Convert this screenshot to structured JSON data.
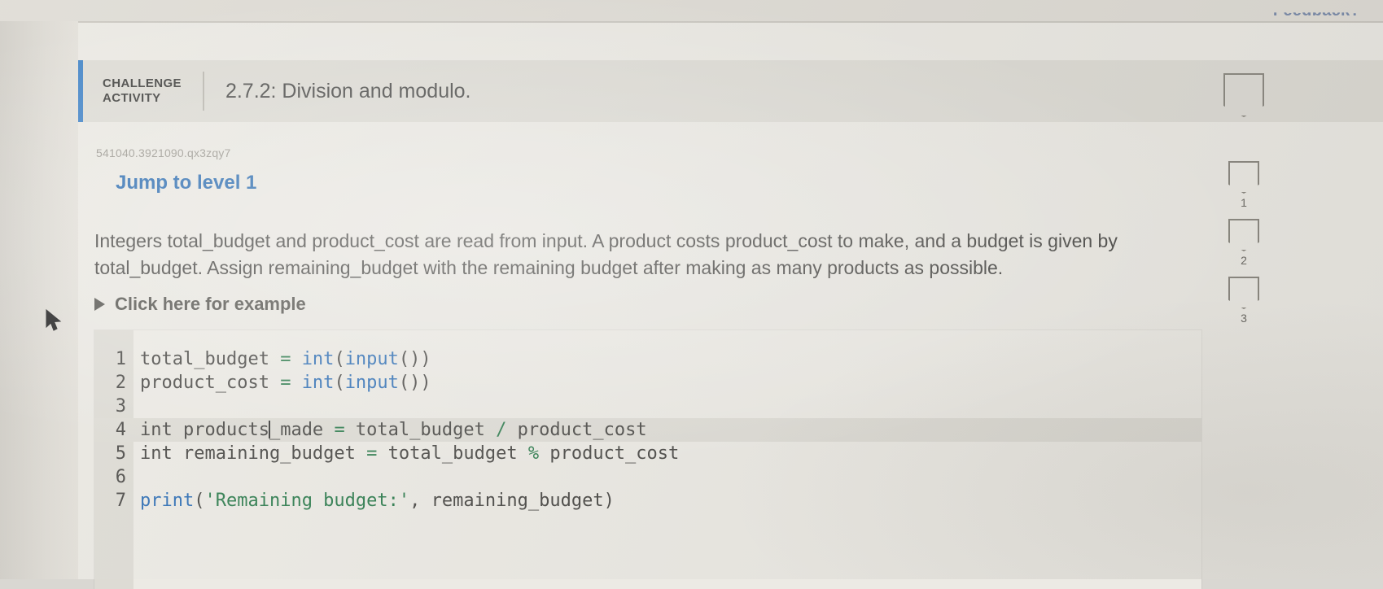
{
  "top_bar": {
    "feedback_label": "Feedback?"
  },
  "header": {
    "challenge_label_line1": "CHALLENGE",
    "challenge_label_line2": "ACTIVITY",
    "title": "2.7.2: Division and modulo.",
    "accent_color": "#3b7fc4"
  },
  "activity": {
    "id": "541040.3921090.qx3zqy7",
    "jump_to_level": "Jump to level 1",
    "instructions": "Integers total_budget and product_cost are read from input. A product costs product_cost to make, and a budget is given by total_budget. Assign remaining_budget with the remaining budget after making as many products as possible.",
    "example_toggle_label": "Click here for example"
  },
  "progress_badges": [
    {
      "label": "",
      "size": "large"
    },
    {
      "label": "1",
      "size": "small"
    },
    {
      "label": "2",
      "size": "small"
    },
    {
      "label": "3",
      "size": "small"
    }
  ],
  "editor": {
    "lines": [
      {
        "number": "1",
        "active": false,
        "tokens": [
          {
            "text": "total_budget ",
            "style": "plain"
          },
          {
            "text": "=",
            "style": "op"
          },
          {
            "text": " ",
            "style": "plain"
          },
          {
            "text": "int",
            "style": "fn"
          },
          {
            "text": "(",
            "style": "plain"
          },
          {
            "text": "input",
            "style": "fn"
          },
          {
            "text": "())",
            "style": "plain"
          }
        ]
      },
      {
        "number": "2",
        "active": false,
        "tokens": [
          {
            "text": "product_cost ",
            "style": "plain"
          },
          {
            "text": "=",
            "style": "op"
          },
          {
            "text": " ",
            "style": "plain"
          },
          {
            "text": "int",
            "style": "fn"
          },
          {
            "text": "(",
            "style": "plain"
          },
          {
            "text": "input",
            "style": "fn"
          },
          {
            "text": "())",
            "style": "plain"
          }
        ]
      },
      {
        "number": "3",
        "active": false,
        "tokens": []
      },
      {
        "number": "4",
        "active": true,
        "tokens": [
          {
            "text": "int products",
            "style": "plain"
          },
          {
            "text": "",
            "style": "caret"
          },
          {
            "text": "_made ",
            "style": "plain"
          },
          {
            "text": "=",
            "style": "op"
          },
          {
            "text": " total_budget ",
            "style": "plain"
          },
          {
            "text": "/",
            "style": "op"
          },
          {
            "text": " product_cost",
            "style": "plain"
          }
        ]
      },
      {
        "number": "5",
        "active": false,
        "tokens": [
          {
            "text": "int remaining_budget ",
            "style": "plain"
          },
          {
            "text": "=",
            "style": "op"
          },
          {
            "text": " total_budget ",
            "style": "plain"
          },
          {
            "text": "%",
            "style": "op"
          },
          {
            "text": " product_cost",
            "style": "plain"
          }
        ]
      },
      {
        "number": "6",
        "active": false,
        "tokens": []
      },
      {
        "number": "7",
        "active": false,
        "tokens": [
          {
            "text": "print",
            "style": "fn"
          },
          {
            "text": "(",
            "style": "plain"
          },
          {
            "text": "'Remaining budget:'",
            "style": "str"
          },
          {
            "text": ", remaining_budget)",
            "style": "plain"
          }
        ]
      }
    ]
  }
}
